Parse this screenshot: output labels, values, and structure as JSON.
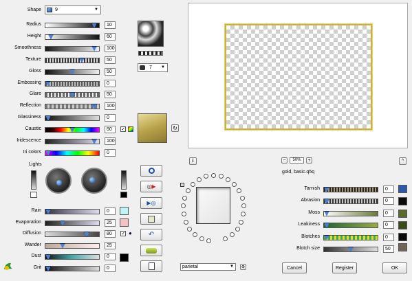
{
  "colors": {
    "accent": "#4a7fd0",
    "gold": "#c9b864"
  },
  "shape": {
    "label": "Shape",
    "value": "9"
  },
  "sliders": [
    {
      "label": "Radius",
      "value": "10",
      "level": 0.95
    },
    {
      "label": "Height",
      "value": "60",
      "level": 0.05
    },
    {
      "label": "Smoothness",
      "value": "100",
      "level": 0.95
    },
    {
      "label": "Texture",
      "value": "50",
      "level": 0.7
    },
    {
      "label": "Gloss",
      "value": "50",
      "level": 0.5
    },
    {
      "label": "Embossing",
      "value": "0",
      "level": 0.0
    },
    {
      "label": "Glare",
      "value": "50",
      "level": 0.5
    },
    {
      "label": "Reflection",
      "value": "100",
      "level": 0.95
    },
    {
      "label": "Glassiness",
      "value": "0",
      "level": 0.0
    },
    {
      "label": "Caustic",
      "value": "50",
      "level": 0.5
    },
    {
      "label": "Iridescence",
      "value": "100",
      "level": 0.95
    },
    {
      "label": "Iri colors",
      "value": "0",
      "level": 0.0
    }
  ],
  "lights": {
    "label": "Lights"
  },
  "bottom_sliders": [
    {
      "label": "Rain",
      "value": "0",
      "level": 0.0
    },
    {
      "label": "Evaporation",
      "value": "25",
      "level": 0.3
    },
    {
      "label": "Diffusion",
      "value": "80",
      "level": 0.8
    },
    {
      "label": "Wander",
      "value": "25",
      "level": 0.3
    },
    {
      "label": "Dust",
      "value": "0",
      "level": 0.0
    },
    {
      "label": "Grit",
      "value": "0",
      "level": 0.0
    }
  ],
  "preset_number": {
    "value": "7"
  },
  "zoom": {
    "value": "50%"
  },
  "preset_name": "gold, basic.q5q",
  "bottom_select": "parietal",
  "right_sliders": [
    {
      "label": "Tarnish",
      "value": "0",
      "level": 0.0
    },
    {
      "label": "Abrasion",
      "value": "0",
      "level": 0.0
    },
    {
      "label": "Moss",
      "value": "0",
      "level": 0.0
    },
    {
      "label": "Leakiness",
      "value": "0",
      "level": 0.0
    },
    {
      "label": "Blotches",
      "value": "0",
      "level": 0.0
    },
    {
      "label": "Blotch size",
      "value": "50",
      "level": 0.5
    }
  ],
  "buttons": {
    "cancel": "Cancel",
    "register": "Register",
    "ok": "OK"
  },
  "info_glyph": "i",
  "expand_glyph": "^",
  "minus_glyph": "−",
  "plus_glyph": "+"
}
